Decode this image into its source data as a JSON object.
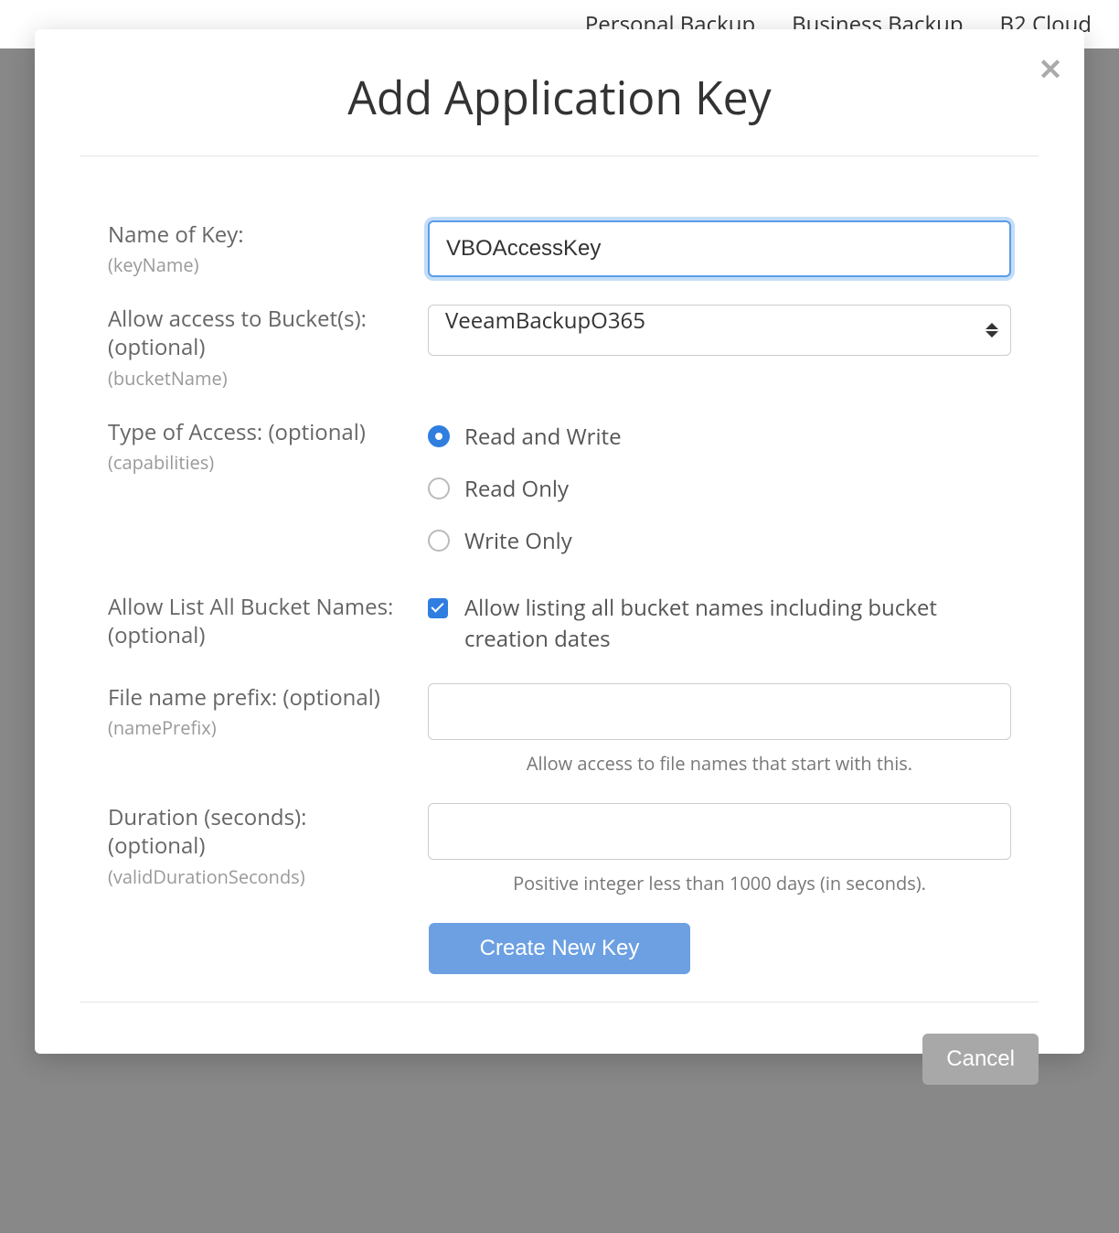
{
  "backdrop": {
    "nav": [
      "Personal Backup",
      "Business Backup",
      "B2 Cloud"
    ]
  },
  "modal": {
    "title": "Add Application Key",
    "fields": {
      "keyName": {
        "label": "Name of Key:",
        "sub": "(keyName)",
        "value": "VBOAccessKey"
      },
      "bucketName": {
        "label": "Allow access to Bucket(s): (optional)",
        "sub": "(bucketName)",
        "value": "VeeamBackupO365"
      },
      "accessType": {
        "label": "Type of Access: (optional)",
        "sub": "(capabilities)",
        "options": {
          "rw": "Read and Write",
          "ro": "Read Only",
          "wo": "Write Only"
        },
        "selected": "rw"
      },
      "listAll": {
        "label": "Allow List All Bucket Names: (optional)",
        "checkLabel": "Allow listing all bucket names including bucket creation dates",
        "checked": true
      },
      "namePrefix": {
        "label": "File name prefix: (optional)",
        "sub": "(namePrefix)",
        "value": "",
        "help": "Allow access to file names that start with this."
      },
      "duration": {
        "label": "Duration (seconds): (optional)",
        "sub": "(validDurationSeconds)",
        "value": "",
        "help": "Positive integer less than 1000 days (in seconds)."
      }
    },
    "actions": {
      "submit": "Create New Key",
      "cancel": "Cancel"
    }
  }
}
